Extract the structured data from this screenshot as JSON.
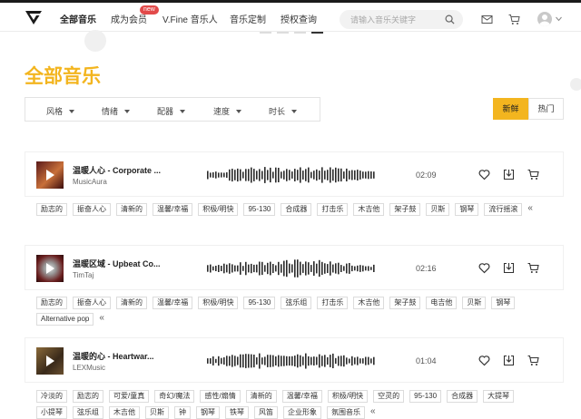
{
  "nav": {
    "items": [
      {
        "label": "全部音乐",
        "active": true
      },
      {
        "label": "成为会员"
      },
      {
        "label": "V.Fine 音乐人"
      },
      {
        "label": "音乐定制"
      },
      {
        "label": "授权查询"
      }
    ],
    "badge": "new",
    "search_placeholder": "请输入音乐关键字"
  },
  "page": {
    "title": "全部音乐"
  },
  "filters": [
    "风格",
    "情绪",
    "配器",
    "速度",
    "时长"
  ],
  "sort": {
    "newest": "新鲜",
    "hot": "热门",
    "active": "newest"
  },
  "colors": {
    "accent": "#f3b51f",
    "badge": "#e24a4a"
  },
  "tracks": [
    {
      "title": "温暖人心 - Corporate ...",
      "artist": "MusicAura",
      "duration": "02:09",
      "tags": [
        "励志的",
        "振奋人心",
        "清新的",
        "温馨/幸福",
        "积极/明快",
        "95-130",
        "合成器",
        "打击乐",
        "木吉他",
        "架子鼓",
        "贝斯",
        "钢琴",
        "流行摇滚"
      ]
    },
    {
      "title": "温暖区域 - Upbeat Co...",
      "artist": "TimTaj",
      "duration": "02:16",
      "tags": [
        "励志的",
        "振奋人心",
        "清新的",
        "温馨/幸福",
        "积极/明快",
        "95-130",
        "弦乐组",
        "打击乐",
        "木吉他",
        "架子鼓",
        "电吉他",
        "贝斯",
        "钢琴",
        "Alternative pop"
      ]
    },
    {
      "title": "温暖的心 - Heartwar...",
      "artist": "LEXMusic",
      "duration": "01:04",
      "tags": [
        "冷淡的",
        "励志的",
        "可爱/童真",
        "奇幻/魔法",
        "感性/煽情",
        "清新的",
        "温馨/幸福",
        "积极/明快",
        "空灵的",
        "95-130",
        "合成器",
        "大提琴",
        "小提琴",
        "弦乐组",
        "木吉他",
        "贝斯",
        "钟",
        "钢琴",
        "铁琴",
        "风笛",
        "企业形象",
        "氛围音乐"
      ]
    }
  ],
  "icons": {
    "logo": "vfine-logo-icon",
    "search": "search-icon",
    "mail": "mail-icon",
    "cart": "cart-icon",
    "avatar": "user-avatar-icon",
    "play": "play-icon",
    "like": "heart-icon",
    "download": "download-icon",
    "add_cart": "cart-icon",
    "collapse": "double-chevron-left-icon"
  }
}
